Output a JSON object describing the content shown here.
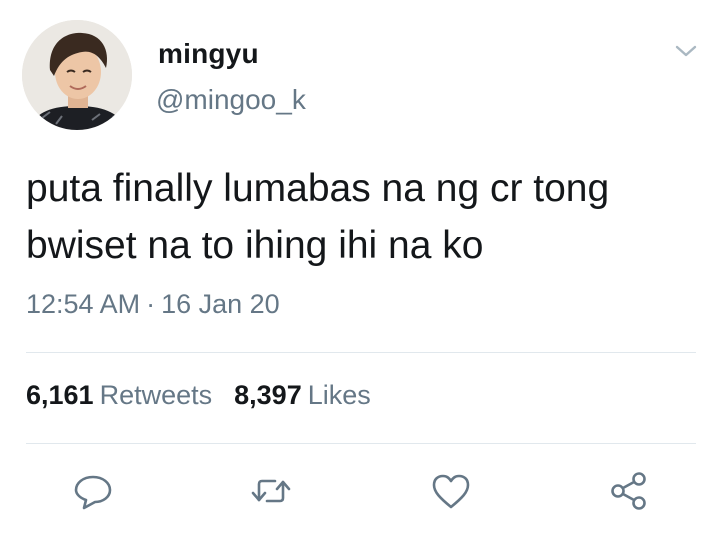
{
  "user": {
    "display_name": "mingyu",
    "handle": "@mingoo_k"
  },
  "tweet": {
    "text_lines": [
      "puta finally lumabas na ng cr tong",
      "bwiset na to ihing ihi na ko"
    ],
    "time": "12:54 AM",
    "separator": "·",
    "date": "16 Jan 20"
  },
  "stats": {
    "retweets_count": "6,161",
    "retweets_label": "Retweets",
    "likes_count": "8,397",
    "likes_label": "Likes"
  },
  "icons": {
    "menu": "chevron-down-icon",
    "reply": "reply-icon",
    "retweet": "retweet-icon",
    "like": "heart-icon",
    "share": "share-icon"
  },
  "colors": {
    "text": "#14171a",
    "secondary": "#657786",
    "divider": "#e1e8ed"
  }
}
